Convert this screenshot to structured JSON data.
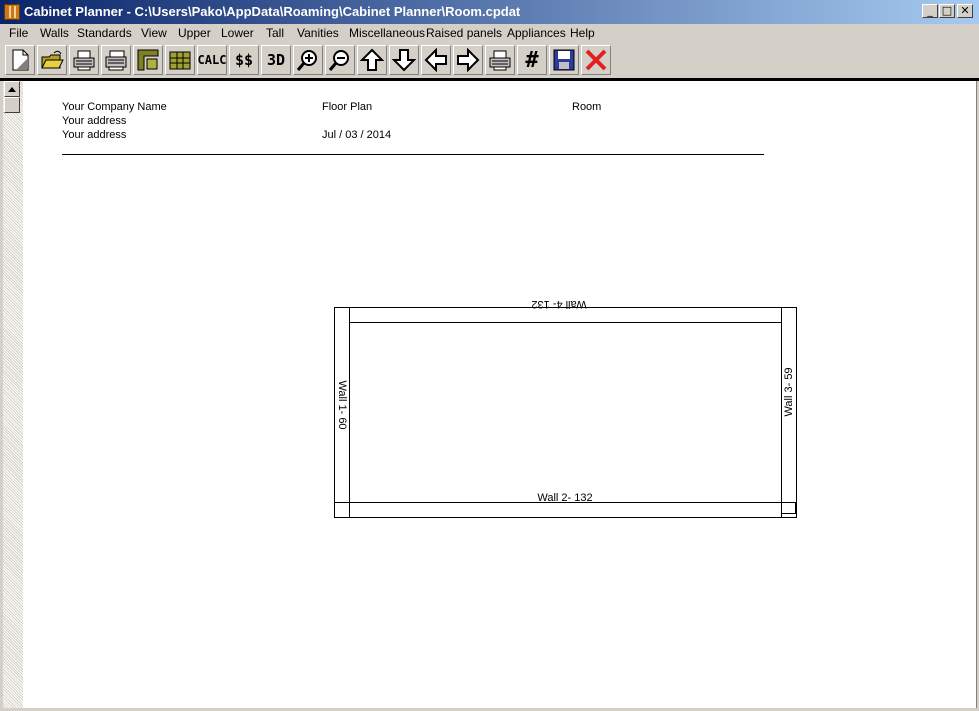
{
  "window": {
    "title": "Cabinet Planner - C:\\Users\\Pako\\AppData\\Roaming\\Cabinet Planner\\Room.cpdat",
    "minimize_glyph": "_",
    "maximize_glyph": "□",
    "close_glyph": "✕"
  },
  "menu": [
    "File",
    "Walls",
    "Standards",
    "View",
    "Upper",
    "Lower",
    "Tall",
    "Vanities",
    "Miscellaneous",
    "Raised panels",
    "Appliances",
    "Help"
  ],
  "toolbar": {
    "buttons": [
      "new-file",
      "open-folder",
      "print",
      "print-preview",
      "corner",
      "cabinet-grid",
      "calc",
      "cost",
      "3d",
      "zoom-in",
      "zoom-out",
      "move-up",
      "move-down",
      "move-left",
      "move-right",
      "printer",
      "grid-hash",
      "save",
      "delete"
    ],
    "calc_label": "CALC",
    "cost_label": "$$",
    "three_d_label": "3D",
    "grid_label": "#"
  },
  "header": {
    "company": "Your Company Name",
    "address1": "Your address",
    "address2": "Your address",
    "doc_title": "Floor Plan",
    "date": "Jul / 03 / 2014",
    "room": "Room"
  },
  "floor_plan": {
    "walls": [
      {
        "id": 1,
        "label": "Wall 1-  60",
        "length": 60
      },
      {
        "id": 2,
        "label": "Wall 2-  132",
        "length": 132
      },
      {
        "id": 3,
        "label": "Wall 3-  59",
        "length": 59
      },
      {
        "id": 4,
        "label": "Wall 4-  132",
        "length": 132
      }
    ]
  },
  "colors": {
    "titlebar_start": "#0a246a",
    "titlebar_end": "#a6caf0",
    "save_icon": "#2a3a9e",
    "delete_icon": "#e02020",
    "folder_icon": "#e8d040"
  }
}
